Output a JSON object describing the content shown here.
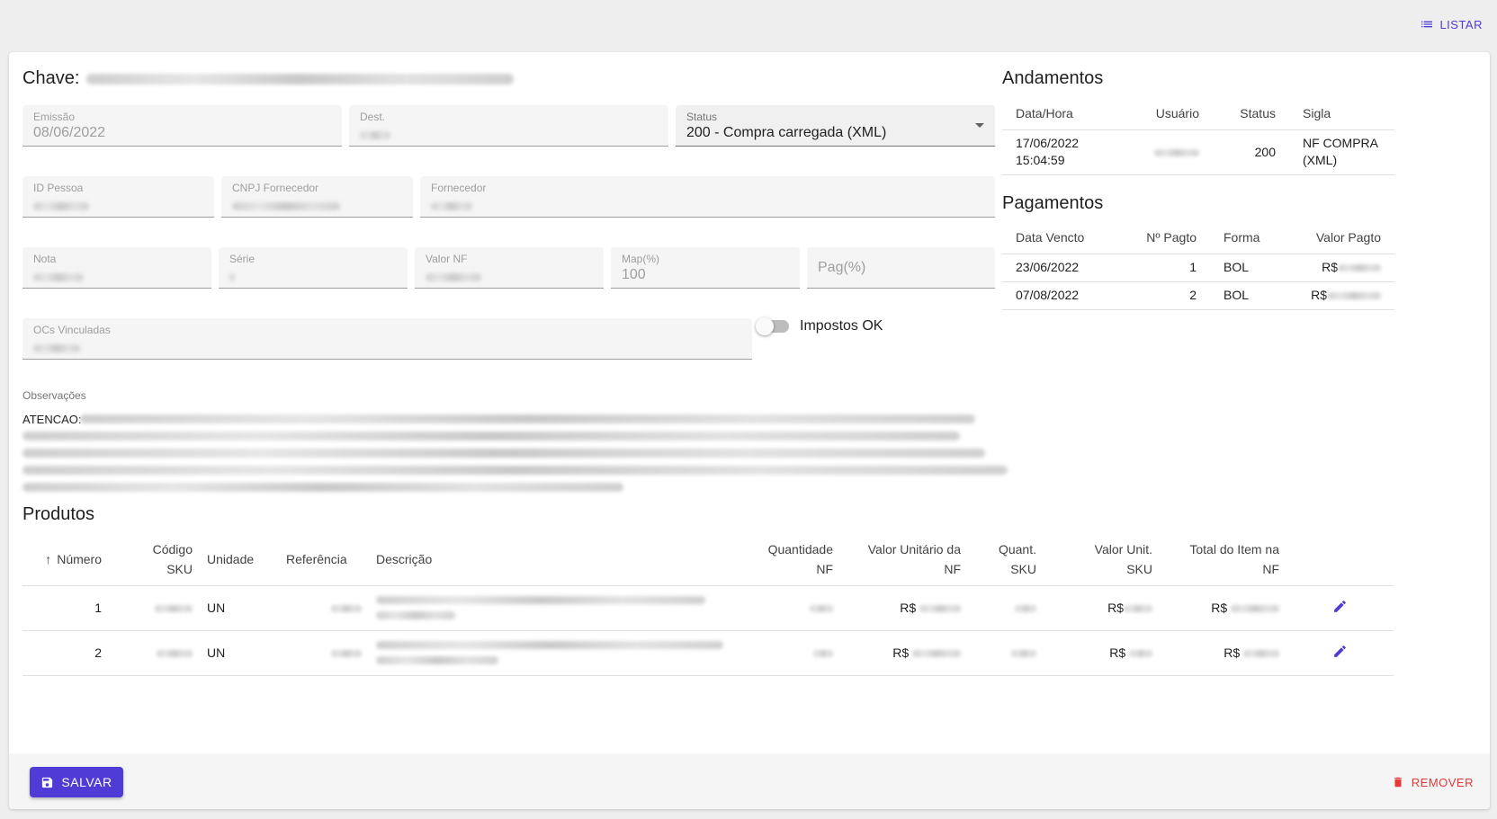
{
  "topbar": {
    "listar_label": "LISTAR"
  },
  "form": {
    "chave_label": "Chave:",
    "emissao": {
      "label": "Emissão",
      "value": "08/06/2022"
    },
    "dest": {
      "label": "Dest."
    },
    "status": {
      "label": "Status",
      "value": "200 - Compra carregada (XML)"
    },
    "id_pessoa": {
      "label": "ID Pessoa"
    },
    "cnpj_fornecedor": {
      "label": "CNPJ Fornecedor"
    },
    "fornecedor": {
      "label": "Fornecedor"
    },
    "nota": {
      "label": "Nota"
    },
    "serie": {
      "label": "Série"
    },
    "valor_nf": {
      "label": "Valor NF"
    },
    "map": {
      "label": "Map(%)",
      "value": "100"
    },
    "pag": {
      "placeholder": "Pag(%)"
    },
    "ocs_vinculadas": {
      "label": "OCs Vinculadas"
    },
    "impostos_ok": {
      "label": "Impostos OK",
      "checked": false
    },
    "observacoes": {
      "label": "Observações",
      "prefix": "ATENCAO:"
    }
  },
  "andamentos": {
    "title": "Andamentos",
    "headers": [
      "Data/Hora",
      "Usuário",
      "Status",
      "Sigla"
    ],
    "rows": [
      {
        "datetime_line1": "17/06/2022",
        "datetime_line2": "15:04:59",
        "status": "200",
        "sigla_line1": "NF COMPRA",
        "sigla_line2": "(XML)"
      }
    ]
  },
  "pagamentos": {
    "title": "Pagamentos",
    "headers": [
      "Data Vencto",
      "Nº Pagto",
      "Forma",
      "Valor Pagto"
    ],
    "rows": [
      {
        "data": "23/06/2022",
        "num": "1",
        "forma": "BOL",
        "valor_prefix": "R$"
      },
      {
        "data": "07/08/2022",
        "num": "2",
        "forma": "BOL",
        "valor_prefix": "R$"
      }
    ]
  },
  "produtos": {
    "title": "Produtos",
    "headers": {
      "numero": "Número",
      "codigo_l1": "Código",
      "codigo_l2": "SKU",
      "unidade": "Unidade",
      "referencia": "Referência",
      "descricao": "Descrição",
      "qtd_l1": "Quantidade",
      "qtd_l2": "NF",
      "vunit_l1": "Valor Unitário da",
      "vunit_l2": "NF",
      "qsku_l1": "Quant.",
      "qsku_l2": "SKU",
      "vsku_l1": "Valor Unit.",
      "vsku_l2": "SKU",
      "total_l1": "Total do Item na",
      "total_l2": "NF"
    },
    "rows": [
      {
        "numero": "1",
        "unidade": "UN",
        "currency": "R$"
      },
      {
        "numero": "2",
        "unidade": "UN",
        "currency": "R$"
      }
    ]
  },
  "footer": {
    "save_label": "SALVAR",
    "remove_label": "REMOVER"
  },
  "colors": {
    "accent": "#4f3bd6",
    "danger": "#e53935"
  }
}
